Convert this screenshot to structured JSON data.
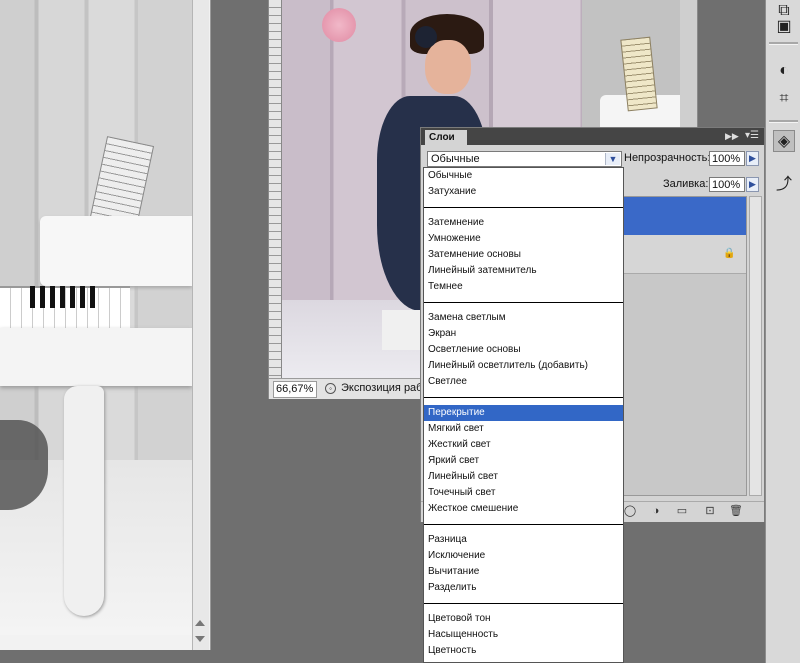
{
  "left_document": {
    "alt": "grayscale photo of girl at piano"
  },
  "center_document": {
    "zoom": "66,67%",
    "status_text": "Экспозиция раб"
  },
  "layers_panel": {
    "tab_label": "Слои",
    "blend_mode_value": "Обычные",
    "opacity_label": "Непрозрачность:",
    "opacity_value": "100%",
    "fill_label": "Заливка:",
    "fill_value": "100%"
  },
  "blend_modes": {
    "groups": [
      [
        "Обычные",
        "Затухание"
      ],
      [
        "Затемнение",
        "Умножение",
        "Затемнение основы",
        "Линейный затемнитель",
        "Темнее"
      ],
      [
        "Замена светлым",
        "Экран",
        "Осветление основы",
        "Линейный осветлитель (добавить)",
        "Светлее"
      ],
      [
        "Перекрытие",
        "Мягкий свет",
        "Жесткий свет",
        "Яркий свет",
        "Линейный свет",
        "Точечный свет",
        "Жесткое смешение"
      ],
      [
        "Разница",
        "Исключение",
        "Вычитание",
        "Разделить"
      ],
      [
        "Цветовой тон",
        "Насыщенность",
        "Цветность"
      ]
    ],
    "selected": "Перекрытие"
  },
  "icons": {
    "toolstrip": [
      "history-icon",
      "swatches-icon",
      "adjustments-icon",
      "transform-icon",
      "layers-icon",
      "paths-icon"
    ],
    "panel_footer": [
      "mask-icon",
      "adjustment-layer-icon",
      "group-icon",
      "new-layer-icon",
      "delete-layer-icon"
    ]
  }
}
